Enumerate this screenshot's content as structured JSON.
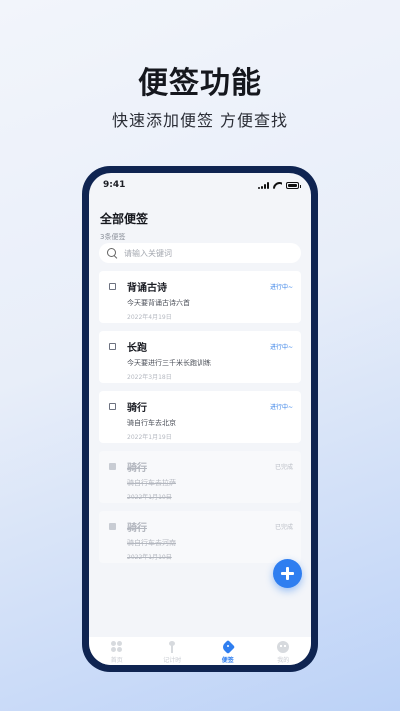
{
  "promo": {
    "title": "便签功能",
    "subtitle": "快速添加便签 方便查找"
  },
  "status_bar": {
    "time": "9:41"
  },
  "header": {
    "title": "全部便签",
    "count": "3条便签"
  },
  "search": {
    "placeholder": "请输入关键词"
  },
  "notes": [
    {
      "title": "背诵古诗",
      "body": "今天要背诵古诗六首",
      "date": "2022年4月19日",
      "status": "进行中~",
      "done": false
    },
    {
      "title": "长跑",
      "body": "今天要进行三千米长跑训练",
      "date": "2022年3月18日",
      "status": "进行中~",
      "done": false
    },
    {
      "title": "骑行",
      "body": "骑自行车去北京",
      "date": "2022年1月19日",
      "status": "进行中~",
      "done": false
    },
    {
      "title": "骑行",
      "body": "骑自行车去拉萨",
      "date": "2022年1月10日",
      "status": "已完成",
      "done": true
    },
    {
      "title": "骑行",
      "body": "骑自行车去河南",
      "date": "2022年1月10日",
      "status": "已完成",
      "done": true
    }
  ],
  "tabbar": {
    "items": [
      {
        "label": "首页",
        "icon": "grid-icon",
        "active": false
      },
      {
        "label": "记计时",
        "icon": "pin-icon",
        "active": false
      },
      {
        "label": "便签",
        "icon": "tag-icon",
        "active": true
      },
      {
        "label": "我的",
        "icon": "face-icon",
        "active": false
      }
    ]
  },
  "colors": {
    "accent": "#2f7ef0",
    "phone_frame": "#0f2451",
    "status_in_progress": "#3a83e8",
    "status_done": "#b8bcc4"
  }
}
